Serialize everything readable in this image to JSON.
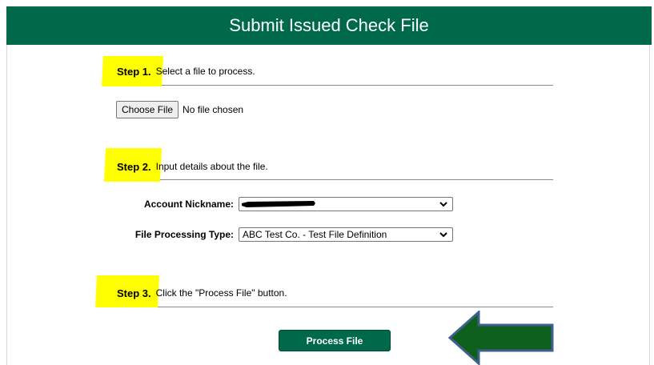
{
  "header": {
    "title": "Submit Issued Check File"
  },
  "step1": {
    "label": "Step 1.",
    "text": "Select a file to process."
  },
  "file_input": {
    "button_label": "Choose File",
    "status": "No file chosen"
  },
  "step2": {
    "label": "Step 2.",
    "text": "Input details about the file."
  },
  "account_nickname": {
    "label": "Account Nickname:",
    "value_redacted": true
  },
  "file_processing_type": {
    "label": "File Processing Type:",
    "value": "ABC Test Co. - Test File Definition"
  },
  "step3": {
    "label": "Step 3.",
    "text": "Click the \"Process File\" button."
  },
  "actions": {
    "process_label": "Process File"
  },
  "colors": {
    "brand_green": "#00694a",
    "highlight_yellow": "#ffff00",
    "arrow_fill": "#0d5f1c",
    "arrow_stroke": "#3f5f8f"
  },
  "icons": {
    "dropdown": "chevron-down-icon",
    "annotation": "arrow-left-icon"
  }
}
